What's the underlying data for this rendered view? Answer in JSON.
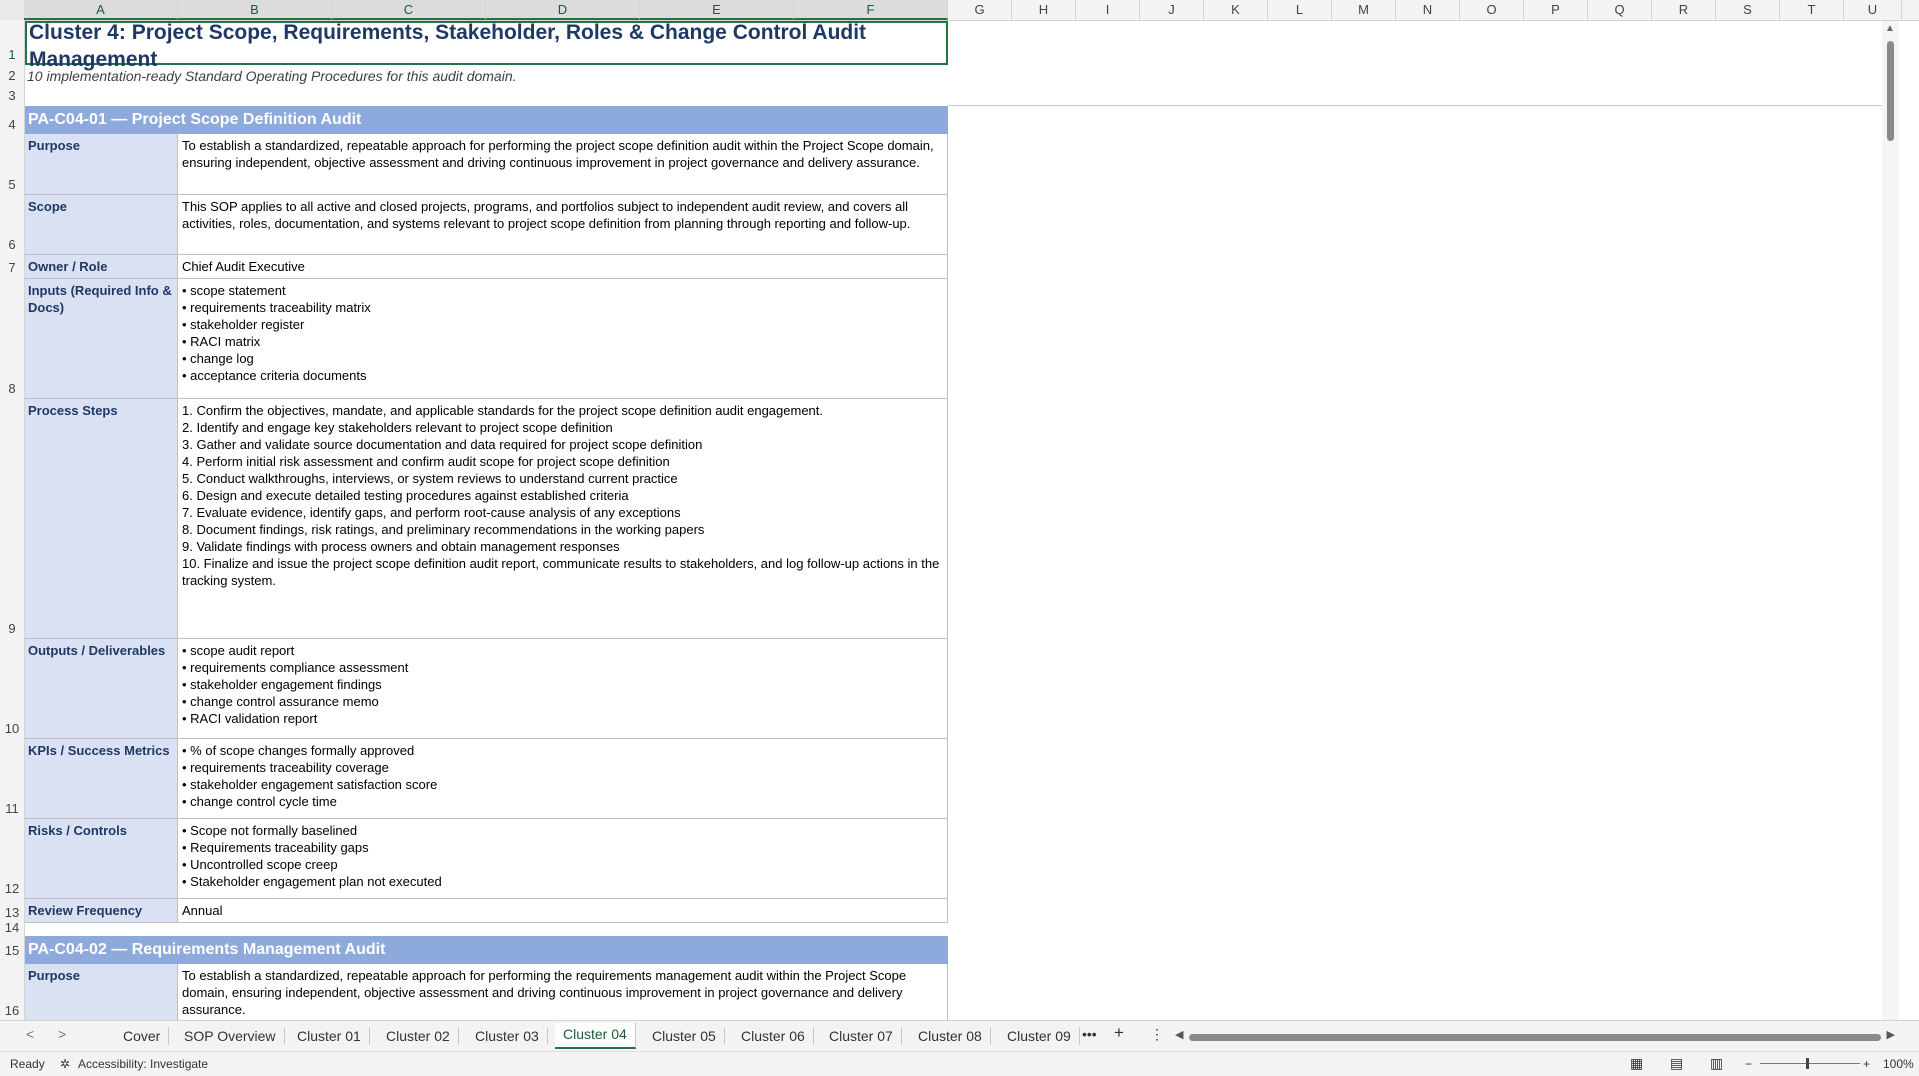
{
  "columns": [
    "A",
    "B",
    "C",
    "D",
    "E",
    "F",
    "G",
    "H",
    "I",
    "J",
    "K",
    "L",
    "M",
    "N",
    "O",
    "P",
    "Q",
    "R",
    "S",
    "T",
    "U"
  ],
  "rows": [
    "1",
    "2",
    "3",
    "4",
    "5",
    "6",
    "7",
    "8",
    "9",
    "10",
    "11",
    "12",
    "13",
    "14",
    "15",
    "16"
  ],
  "title": "Cluster 4: Project Scope, Requirements, Stakeholder, Roles & Change Control Audit Management",
  "subtitle": "10 implementation-ready Standard Operating Procedures for this audit domain.",
  "sop1": {
    "header": "PA-C04-01  —  Project Scope Definition Audit",
    "purpose_label": "Purpose",
    "purpose": "To establish a standardized, repeatable approach for performing the project scope definition audit within the Project Scope domain, ensuring independent, objective assessment and driving continuous improvement in project governance and delivery assurance.",
    "scope_label": "Scope",
    "scope": "This SOP applies to all active and closed projects, programs, and portfolios subject to independent audit review, and covers all activities, roles, documentation, and systems relevant to project scope definition from planning through reporting and follow-up.",
    "owner_label": "Owner / Role",
    "owner": "Chief Audit Executive",
    "inputs_label": "Inputs (Required Info & Docs)",
    "inputs": [
      "• scope statement",
      "• requirements traceability matrix",
      "• stakeholder register",
      "• RACI matrix",
      "• change log",
      "• acceptance criteria documents"
    ],
    "steps_label": "Process Steps",
    "steps": [
      "1. Confirm the objectives, mandate, and applicable standards for the project scope definition audit engagement.",
      "2. Identify and engage key stakeholders relevant to project scope definition",
      "3. Gather and validate source documentation and data required for project scope definition",
      "4. Perform initial risk assessment and confirm audit scope for project scope definition",
      "5. Conduct walkthroughs, interviews, or system reviews to understand current practice",
      "6. Design and execute detailed testing procedures against established criteria",
      "7. Evaluate evidence, identify gaps, and perform root-cause analysis of any exceptions",
      "8. Document findings, risk ratings, and preliminary recommendations in the working papers",
      "9. Validate findings with process owners and obtain management responses",
      "10. Finalize and issue the project scope definition audit report, communicate results to stakeholders, and log follow-up actions in the tracking system."
    ],
    "outputs_label": "Outputs / Deliverables",
    "outputs": [
      "• scope audit report",
      "• requirements compliance assessment",
      "• stakeholder engagement findings",
      "• change control assurance memo",
      "• RACI validation report"
    ],
    "kpis_label": "KPIs / Success Metrics",
    "kpis": [
      "• % of scope changes formally approved",
      "• requirements traceability coverage",
      "• stakeholder engagement satisfaction score",
      "• change control cycle time"
    ],
    "risks_label": "Risks / Controls",
    "risks": [
      "• Scope not formally baselined",
      "• Requirements traceability gaps",
      "• Uncontrolled scope creep",
      "• Stakeholder engagement plan not executed"
    ],
    "review_label": "Review Frequency",
    "review": "Annual"
  },
  "sop2": {
    "header": "PA-C04-02  —  Requirements Management Audit",
    "purpose_label": "Purpose",
    "purpose": "To establish a standardized, repeatable approach for performing the requirements management audit within the Project Scope domain, ensuring independent, objective assessment and driving continuous improvement in project governance and delivery assurance."
  },
  "tabs": [
    "Cover",
    "SOP Overview",
    "Cluster 01",
    "Cluster 02",
    "Cluster 03",
    "Cluster 04",
    "Cluster 05",
    "Cluster 06",
    "Cluster 07",
    "Cluster 08",
    "Cluster 09"
  ],
  "active_tab": "Cluster 04",
  "status": {
    "ready": "Ready",
    "accessibility": "Accessibility: Investigate",
    "zoom": "100%"
  }
}
